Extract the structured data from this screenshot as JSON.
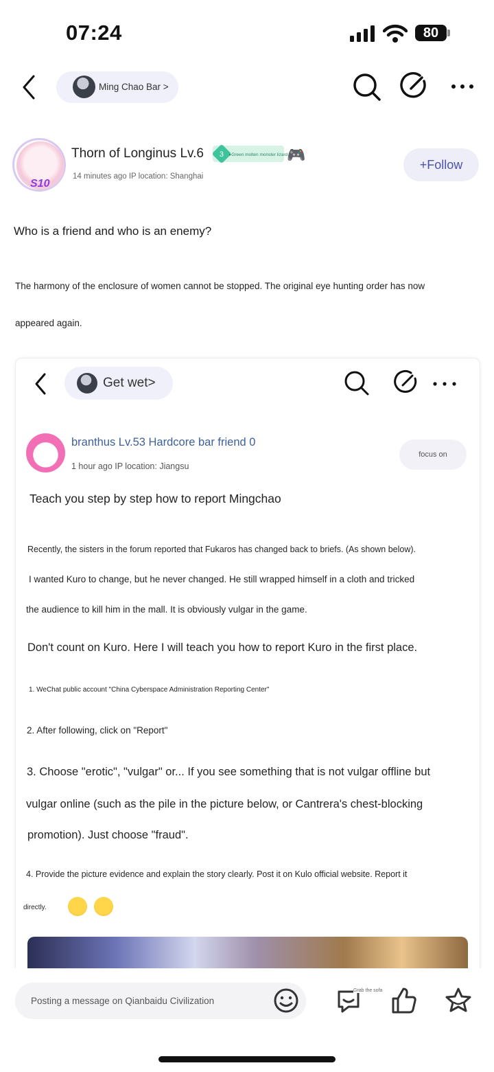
{
  "status_bar": {
    "time": "07:24",
    "battery": "80"
  },
  "header": {
    "bar_name": "Ming Chao Bar >"
  },
  "author": {
    "name": "Thorn of Longinus Lv.6",
    "avatar_badge": "S10",
    "level_badge": "3",
    "badge_title": "▸Green molten monster lizard",
    "meta": "14 minutes ago IP location: Shanghai",
    "follow_label": "+Follow"
  },
  "post": {
    "title": "Who is a friend and who is an enemy?",
    "body_line1": "The harmony of the enclosure of women cannot be stopped. The original eye hunting order has now",
    "body_line2": "appeared again."
  },
  "embedded": {
    "bar_name": "Get wet>",
    "author_line": "branthus Lv.53 Hardcore bar friend 0",
    "meta": "1 hour ago IP location: Jiangsu",
    "follow_label": "focus on",
    "title": "Teach you step by step how to report Mingchao",
    "lines": {
      "p1": "Recently, the sisters in the forum reported that Fukaros has changed back to briefs. (As shown below).",
      "p2": "I wanted Kuro to change, but he never changed. He still wrapped himself in a cloth and tricked",
      "p3": "the audience to kill him in the mall. It is obviously vulgar in the game.",
      "p4": "Don't count on Kuro. Here I will teach you how to report Kuro in the first place.",
      "p5": "1. WeChat public account \"China Cyberspace Administration Reporting Center\"",
      "p6": "2. After following, click on \"Report\"",
      "p7": "3. Choose \"erotic\", \"vulgar\" or... If you see something that is not vulgar offline but",
      "p8": "vulgar online (such as the pile in the picture below, or Cantrera's chest-blocking",
      "p9": "promotion). Just choose \"fraud\".",
      "p10": "4. Provide the picture evidence and explain the story clearly. Post it on Kulo official website. Report it",
      "p11": "directly."
    }
  },
  "bottom_bar": {
    "input_placeholder": "Posting a message on Qianbaidu Civilization",
    "sofa_label": "Grab the sofa"
  },
  "icons": [
    "back-icon",
    "search-icon",
    "edit-icon",
    "more-icon",
    "smiley-icon",
    "comment-icon",
    "like-icon",
    "star-icon",
    "signal-icon",
    "wifi-icon"
  ]
}
